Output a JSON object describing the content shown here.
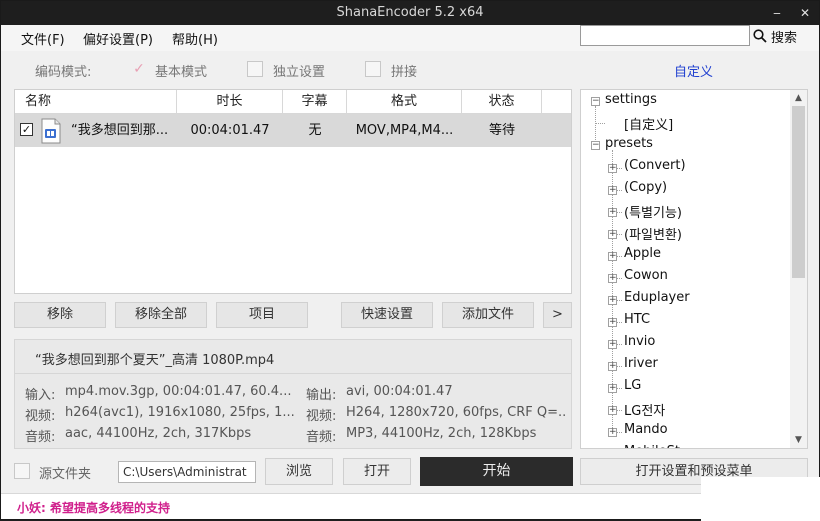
{
  "window": {
    "title": "ShanaEncoder 5.2 x64",
    "minimize_glyph": "‒",
    "close_glyph": "✕"
  },
  "menu": [
    "文件(F)",
    "偏好设置(P)",
    "帮助(H)"
  ],
  "search": {
    "placeholder": "",
    "button_label": "搜索",
    "icon": "search-icon"
  },
  "mode": {
    "label": "编码模式:",
    "options": [
      {
        "label": "基本模式",
        "checked": true
      },
      {
        "label": "独立设置",
        "checked": false
      },
      {
        "label": "拼接",
        "checked": false
      }
    ],
    "custom_link": "自定义"
  },
  "table": {
    "columns": [
      "名称",
      "时长",
      "字幕",
      "格式",
      "状态"
    ],
    "rows": [
      {
        "name": "“我多想回到那...",
        "duration": "00:04:01.47",
        "subtitle": "无",
        "format": "MOV,MP4,M4...",
        "status": "等待",
        "checked": true
      }
    ]
  },
  "file_buttons": [
    "移除",
    "移除全部",
    "项目",
    "快速设置",
    "添加文件",
    ">"
  ],
  "info": {
    "filename": "“我多想回到那个夏天”_高清 1080P.mp4",
    "input": {
      "label": "输入:",
      "value": "mp4.mov.3gp, 00:04:01.47, 60.4..."
    },
    "video_in": {
      "label": "视频:",
      "value": "h264(avc1), 1916x1080, 25fps, 1..."
    },
    "audio_in": {
      "label": "音频:",
      "value": "aac, 44100Hz, 2ch, 317Kbps"
    },
    "output": {
      "label": "输出:",
      "value": "avi, 00:04:01.47"
    },
    "video_out": {
      "label": "视频:",
      "value": "H264, 1280x720, 60fps, CRF Q=..."
    },
    "audio_out": {
      "label": "音频:",
      "value": "MP3, 44100Hz, 2ch, 128Kbps"
    }
  },
  "tree": {
    "settings_label": "settings",
    "settings_child": "[自定义]",
    "presets_label": "presets",
    "presets": [
      "(Convert)",
      "(Copy)",
      "(특별기능)",
      "(파일변환)",
      "Apple",
      "Cowon",
      "Eduplayer",
      "HTC",
      "Invio",
      "Iriver",
      "LG",
      "LG전자",
      "Mando",
      "MobileSt..."
    ]
  },
  "bottom": {
    "source_folder_label": "源文件夹",
    "path": "C:\\Users\\Administrat",
    "browse": "浏览",
    "open": "打开",
    "start": "开始",
    "open_settings": "打开设置和预设菜单"
  },
  "status": {
    "message": "小妖: 希望提高多线程的支持",
    "color": "#d0208c"
  }
}
